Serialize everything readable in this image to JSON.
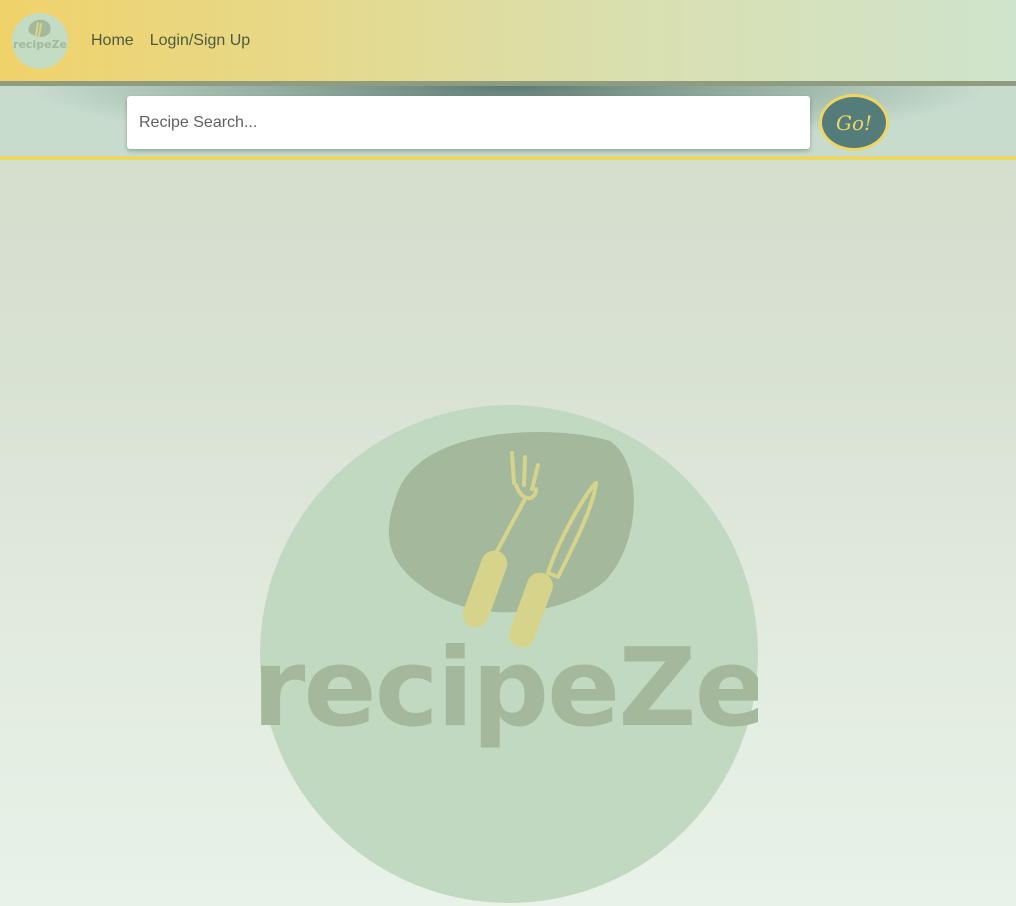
{
  "nav": {
    "logo_text": "recipeZe",
    "links": [
      {
        "label": "Home"
      },
      {
        "label": "Login/Sign Up"
      }
    ]
  },
  "search": {
    "placeholder": "Recipe Search...",
    "value": "",
    "button_label": "Go!"
  },
  "hero": {
    "logo_text": "recipeZe",
    "logo_icon": "fork-knife-icon"
  },
  "colors": {
    "accent_yellow": "#eed665",
    "button_teal": "#537c7a",
    "logo_circle": "#c2d9c1",
    "logo_blob": "#a4b89c",
    "logo_utensils": "#d6d48a"
  }
}
